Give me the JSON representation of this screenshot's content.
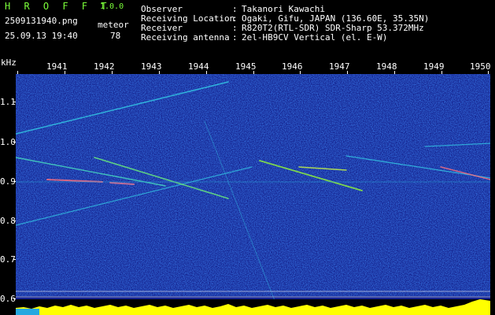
{
  "app": {
    "name": "H R O F F T",
    "version": "1.0.0"
  },
  "file": {
    "name": "2509131940.png",
    "datetime": "25.09.13 19:40"
  },
  "meteor": {
    "label": "meteor",
    "count": "78"
  },
  "info": [
    {
      "key": "Observer",
      "value": "Takanori Kawachi"
    },
    {
      "key": "Receiving Location",
      "value": "Ogaki, Gifu, JAPAN (136.60E, 35.35N)"
    },
    {
      "key": "Receiver",
      "value": "R820T2(RTL-SDR) SDR-Sharp 53.372MHz"
    },
    {
      "key": "Receiving antenna",
      "value": "2el-HB9CV Vertical (el. E-W)"
    }
  ],
  "info_separator": ":",
  "axis": {
    "unit": "kHz",
    "time_labels": [
      "1941",
      "1942",
      "1943",
      "1944",
      "1945",
      "1946",
      "1947",
      "1948",
      "1949",
      "1950"
    ],
    "freq_labels": [
      "1.1",
      "1.0",
      "0.9",
      "0.8",
      "0.7",
      "0.6"
    ]
  },
  "colors": {
    "accent": "#7CFF3A",
    "background": "#1a2a9a",
    "level": "#ffff00"
  }
}
